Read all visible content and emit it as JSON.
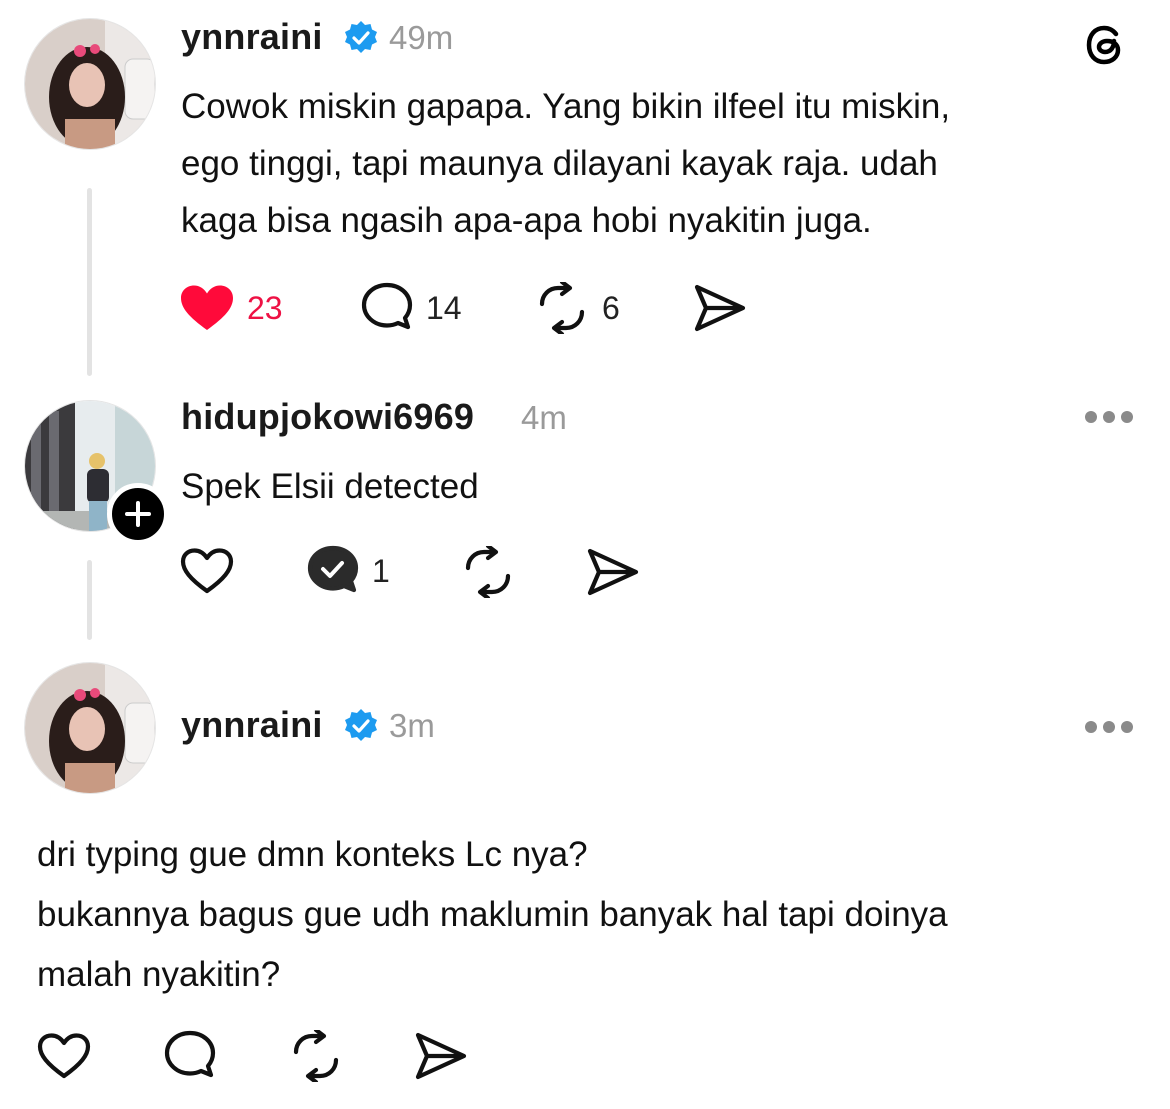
{
  "posts": [
    {
      "username": "ynnraini",
      "verified": true,
      "time": "49m",
      "text_lines": [
        "Cowok miskin gapapa. Yang bikin ilfeel itu miskin,",
        "ego tinggi, tapi maunya dilayani kayak raja. udah",
        "kaga bisa ngasih apa-apa hobi nyakitin juga."
      ],
      "actions": {
        "likes": "23",
        "liked": true,
        "replies": "14",
        "reposts": "6"
      }
    },
    {
      "username": "hidupjokowi6969",
      "verified": false,
      "time": "4m",
      "text_lines": [
        "Spek Elsii detected"
      ],
      "actions": {
        "likes": "",
        "liked": false,
        "replies": "1",
        "reposts": ""
      }
    },
    {
      "username": "ynnraini",
      "verified": true,
      "time": "3m",
      "text_lines": [
        "dri typing gue dmn konteks Lc nya?",
        "bukannya bagus gue udh maklumin banyak hal tapi doinya",
        "malah nyakitin?"
      ],
      "actions": {
        "likes": "",
        "liked": false,
        "replies": "",
        "reposts": ""
      }
    }
  ],
  "icons": {
    "app": "threads-logo-icon",
    "verified": "verified-badge-icon",
    "like": "heart-icon",
    "reply": "comment-icon",
    "repost": "repost-icon",
    "share": "send-icon",
    "more": "more-options-icon",
    "follow": "plus-icon"
  },
  "colors": {
    "verified": "#1d9bf0",
    "liked": "#ee1144",
    "muted": "#9a9a9a",
    "thread_line": "#e3e3e3"
  }
}
